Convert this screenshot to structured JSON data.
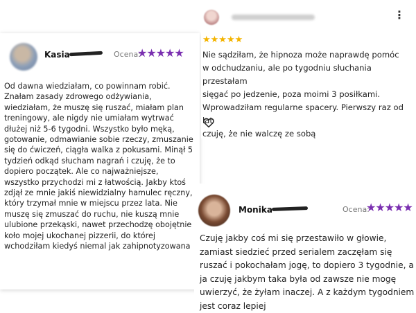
{
  "review_left": {
    "name": "Kasia",
    "rating_label": "Ocena:",
    "stars": "★★★★★",
    "text": "Od dawna wiedziałam, co powinnam robić. Znałam zasady zdrowego odżywiania, wiedziałam, że muszę się ruszać, miałam plan treningowy, ale nigdy nie umiałam wytrwać dłużej niż 5-6 tygodni. Wszystko było męką, gotowanie, odmawianie sobie rzeczy, zmuszanie się do ćwiczeń, ciągła walka z pokusami. Minął 5 tydzień odkąd słucham nagrań i czuję, że to dopiero początek. Ale co najważniejsze, wszystko przychodzi mi z łatwością. Jakby ktoś zdjął ze mnie jakiś niewidzialny hamulec ręczny, który trzymał mnie w miejscu przez lata. Nie muszę się zmuszać do ruchu, nie kuszą mnie ulubione przekąski, nawet przechodzę obojętnie koło mojej ukochanej pizzerii, do której wchodziłam kiedyś niemal jak zahipnotyzowana"
  },
  "review_gmaps": {
    "stars": "★★★★★",
    "menu_icon": "⋮",
    "text": "Nie sądziłam, że hipnoza może naprawdę pomóc w odchudzaniu, ale po tygodniu słuchania przestałam sięgać po jedzenie, poza moimi 3 posiłkami. Wprowadziłam regularne spacery. Pierwszy raz od lat czuję, że nie walczę ze sobą",
    "lines": [
      "Nie sądziłam, że hipnoza może naprawdę pomóc",
      "w odchudzaniu, ale po tygodniu słuchania przestałam",
      "sięgać po jedzenie, poza moimi 3 posiłkami.",
      "Wprowadziłam regularne spacery. Pierwszy raz od lat",
      "czuję, że nie walczę ze sobą"
    ],
    "star_color": "#f4b400"
  },
  "review_right": {
    "name": "Monika",
    "rating_label": "Ocena:",
    "stars": "★★★★★",
    "lines": [
      "Czuję jakby coś mi się przestawiło w głowie,",
      "zamiast siedzieć przed serialem zaczęłam się",
      "ruszać i pokochałam jogę, to dopiero 3 tygodnie, a",
      "ja czuję jakbym taka była od zawsze nie mogę",
      "uwierzyć, że żyłam inaczej. A z każdym tygodniem",
      "jest coraz lepiej"
    ],
    "star_color": "#7a2fb0"
  }
}
